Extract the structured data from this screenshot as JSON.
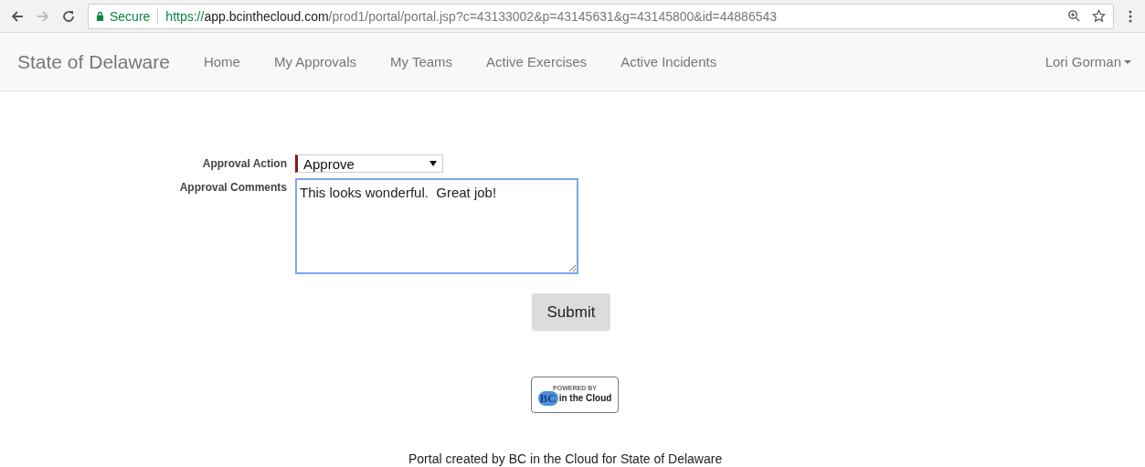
{
  "browser": {
    "secure_label": "Secure",
    "url": {
      "scheme": "https://",
      "host": "app.bcinthecloud.com",
      "path": "/prod1/portal/portal.jsp?c=43133002&p=43145631&g=43145800&id=44886543"
    }
  },
  "navbar": {
    "brand": "State of Delaware",
    "links": [
      {
        "label": "Home",
        "selected": false
      },
      {
        "label": "My Approvals",
        "selected": false
      },
      {
        "label": "My Teams",
        "selected": false
      },
      {
        "label": "Active Exercises",
        "selected": false
      },
      {
        "label": "Active Incidents",
        "selected": false
      }
    ],
    "user": "Lori Gorman"
  },
  "form": {
    "action_label": "Approval Action",
    "action_value": "Approve",
    "action_required": true,
    "comments_label": "Approval Comments",
    "comments_value": "This looks wonderful.  Great job!",
    "submit": "Submit"
  },
  "badge": {
    "top": "POWERED BY",
    "mark": "BC",
    "name": "in the Cloud"
  },
  "footer": "Portal created by BC in the Cloud for State of Delaware"
}
